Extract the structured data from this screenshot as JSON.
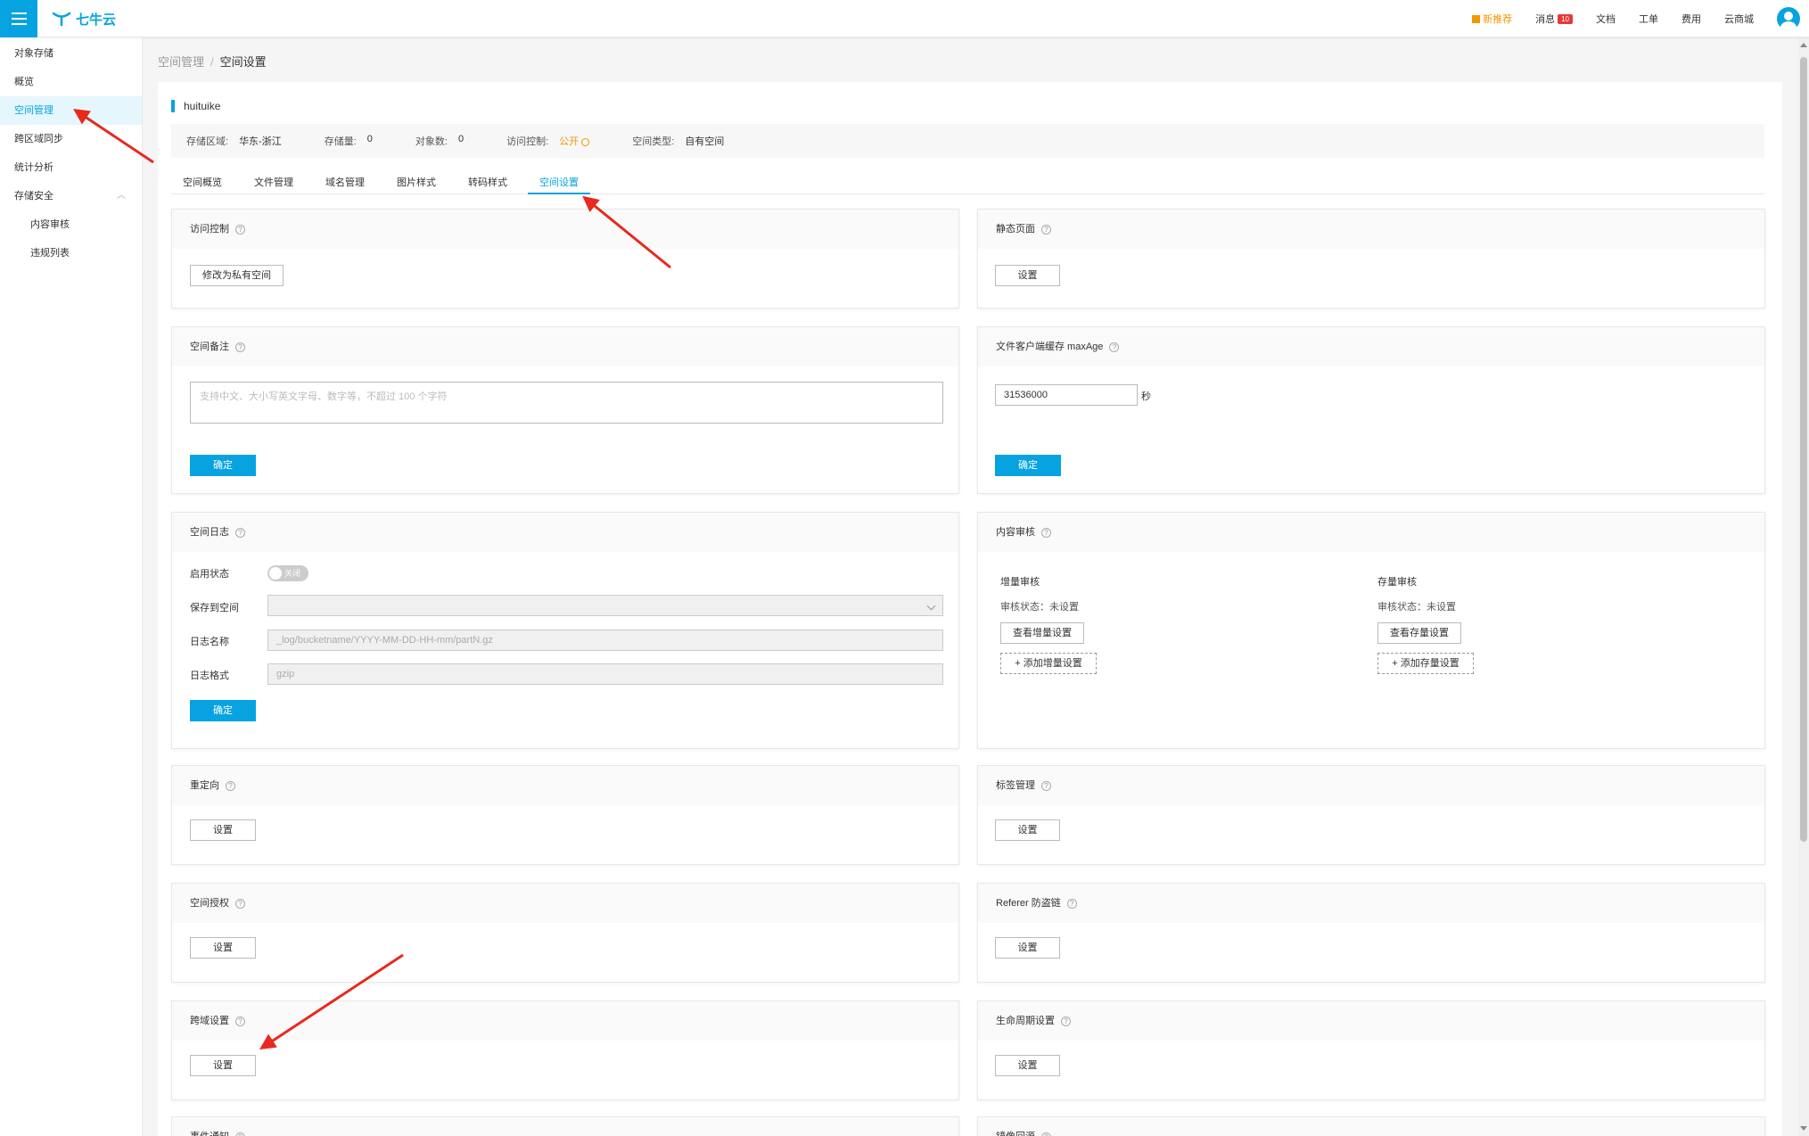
{
  "topbar": {
    "logo_text": "七牛云",
    "nav": [
      {
        "label": "新推荐",
        "icon": "gift-icon",
        "promo": true
      },
      {
        "label": "消息",
        "badge": "10"
      },
      {
        "label": "文档"
      },
      {
        "label": "工单"
      },
      {
        "label": "费用"
      },
      {
        "label": "云商城"
      }
    ]
  },
  "sidebar": {
    "items": [
      {
        "label": "对象存储"
      },
      {
        "label": "概览"
      },
      {
        "label": "空间管理",
        "active": true
      },
      {
        "label": "跨区域同步"
      },
      {
        "label": "统计分析"
      },
      {
        "label": "存储安全",
        "expanded": true
      },
      {
        "label": "内容审核",
        "sub": true
      },
      {
        "label": "违规列表",
        "sub": true
      }
    ]
  },
  "breadcrumb": {
    "parent": "空间管理",
    "sep": "/",
    "current": "空间设置"
  },
  "bucket": {
    "name": "huituike",
    "info": [
      {
        "label": "存储区域:",
        "value": "华东-浙江"
      },
      {
        "label": "存储量:",
        "value": "0"
      },
      {
        "label": "对象数:",
        "value": "0"
      },
      {
        "label": "访问控制:",
        "value": "公开"
      },
      {
        "label": "空间类型:",
        "value": "自有空间"
      }
    ]
  },
  "tabs": [
    {
      "label": "空间概览"
    },
    {
      "label": "文件管理"
    },
    {
      "label": "域名管理"
    },
    {
      "label": "图片样式"
    },
    {
      "label": "转码样式"
    },
    {
      "label": "空间设置",
      "active": true
    }
  ],
  "panels": {
    "access": {
      "title": "访问控制",
      "button": "修改为私有空间"
    },
    "static": {
      "title": "静态页面",
      "button": "设置"
    },
    "remark": {
      "title": "空间备注",
      "placeholder": "支持中文、大小写英文字母、数字等，不超过 100 个字符",
      "confirm": "确定"
    },
    "maxage": {
      "title": "文件客户端缓存 maxAge",
      "value": "31536000",
      "unit": "秒",
      "confirm": "确定"
    },
    "log": {
      "title": "空间日志",
      "status_label": "启用状态",
      "toggle_text": "关闭",
      "bucket_label": "保存到空间",
      "name_label": "日志名称",
      "name_placeholder": "_log/bucketname/YYYY-MM-DD-HH-mm/partN.gz",
      "format_label": "日志格式",
      "format_placeholder": "gzip",
      "confirm": "确定"
    },
    "audit": {
      "title": "内容审核",
      "incremental": {
        "title": "增量审核",
        "status": "审核状态：未设置",
        "view": "查看增量设置",
        "add": "+ 添加增量设置"
      },
      "stock": {
        "title": "存量审核",
        "status": "审核状态：未设置",
        "view": "查看存量设置",
        "add": "+ 添加存量设置"
      }
    },
    "redirect": {
      "title": "重定向",
      "button": "设置"
    },
    "tags": {
      "title": "标签管理",
      "button": "设置"
    },
    "auth": {
      "title": "空间授权",
      "button": "设置"
    },
    "referer": {
      "title": "Referer 防盗链",
      "button": "设置"
    },
    "cors": {
      "title": "跨域设置",
      "button": "设置"
    },
    "lifecycle": {
      "title": "生命周期设置",
      "button": "设置"
    },
    "event": {
      "title": "事件通知"
    },
    "mirror": {
      "title": "镜像回源"
    }
  },
  "colors": {
    "accent": "#06a3e0",
    "promo": "#f39800",
    "badge": "#e53935",
    "arrow": "#e8291c"
  }
}
